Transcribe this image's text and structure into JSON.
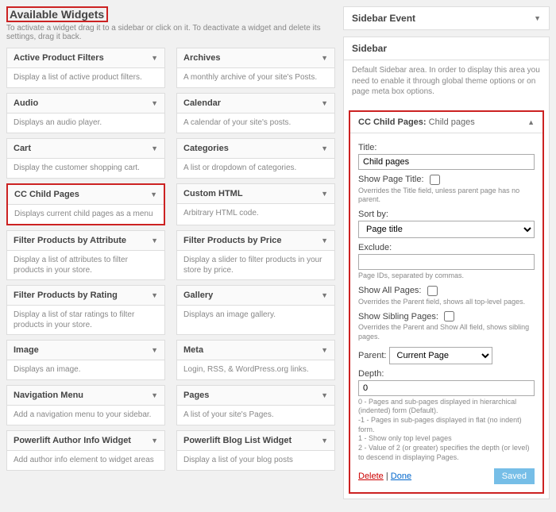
{
  "header": {
    "title": "Available Widgets",
    "hint": "To activate a widget drag it to a sidebar or click on it. To deactivate a widget and delete its settings, drag it back."
  },
  "widgets": [
    {
      "name": "Active Product Filters",
      "desc": "Display a list of active product filters."
    },
    {
      "name": "Archives",
      "desc": "A monthly archive of your site's Posts."
    },
    {
      "name": "Audio",
      "desc": "Displays an audio player."
    },
    {
      "name": "Calendar",
      "desc": "A calendar of your site's posts."
    },
    {
      "name": "Cart",
      "desc": "Display the customer shopping cart."
    },
    {
      "name": "Categories",
      "desc": "A list or dropdown of categories."
    },
    {
      "name": "CC Child Pages",
      "desc": "Displays current child pages as a menu"
    },
    {
      "name": "Custom HTML",
      "desc": "Arbitrary HTML code."
    },
    {
      "name": "Filter Products by Attribute",
      "desc": "Display a list of attributes to filter products in your store."
    },
    {
      "name": "Filter Products by Price",
      "desc": "Display a slider to filter products in your store by price."
    },
    {
      "name": "Filter Products by Rating",
      "desc": "Display a list of star ratings to filter products in your store."
    },
    {
      "name": "Gallery",
      "desc": "Displays an image gallery."
    },
    {
      "name": "Image",
      "desc": "Displays an image."
    },
    {
      "name": "Meta",
      "desc": "Login, RSS, & WordPress.org links."
    },
    {
      "name": "Navigation Menu",
      "desc": "Add a navigation menu to your sidebar."
    },
    {
      "name": "Pages",
      "desc": "A list of your site's Pages."
    },
    {
      "name": "Powerlift Author Info Widget",
      "desc": "Add author info element to widget areas"
    },
    {
      "name": "Powerlift Blog List Widget",
      "desc": "Display a list of your blog posts"
    }
  ],
  "sidebarEvent": {
    "title": "Sidebar Event"
  },
  "sidebar": {
    "title": "Sidebar",
    "note": "Default Sidebar area. In order to display this area you need to enable it through global theme options or on page meta box options.",
    "active": {
      "header": "CC Child Pages:",
      "sub": "Child pages",
      "title_label": "Title:",
      "title_value": "Child pages",
      "show_title": "Show Page Title:",
      "show_title_help": "Overrides the Title field, unless parent page has no parent.",
      "sortby": "Sort by:",
      "sortby_value": "Page title",
      "exclude": "Exclude:",
      "exclude_help": "Page IDs, separated by commas.",
      "show_all": "Show All Pages:",
      "show_all_help": "Overrides the Parent field, shows all top-level pages.",
      "show_sib": "Show Sibling Pages:",
      "show_sib_help": "Overrides the Parent and Show All field, shows sibling pages.",
      "parent": "Parent:",
      "parent_value": "Current Page",
      "depth": "Depth:",
      "depth_value": "0",
      "depth_help": "0 - Pages and sub-pages displayed in hierarchical (indented) form (Default).\n-1 - Pages in sub-pages displayed in flat (no indent) form.\n1 - Show only top level pages\n2 - Value of 2 (or greater) specifies the depth (or level) to descend in displaying Pages.",
      "delete": "Delete",
      "done": "Done",
      "saved": "Saved"
    }
  }
}
